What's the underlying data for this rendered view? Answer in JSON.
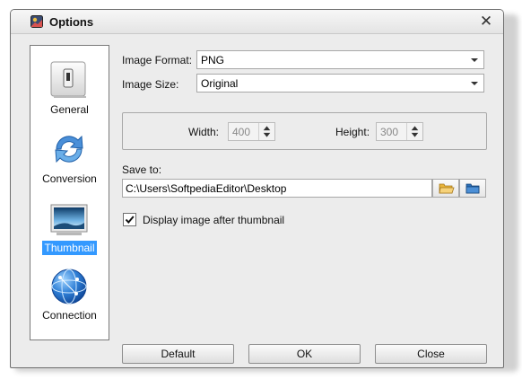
{
  "window": {
    "title": "Options",
    "close_glyph": "✕"
  },
  "sidebar": {
    "items": [
      {
        "label": "General",
        "icon": "switch-icon"
      },
      {
        "label": "Conversion",
        "icon": "refresh-arrows-icon"
      },
      {
        "label": "Thumbnail",
        "icon": "landscape-image-icon",
        "selected": true
      },
      {
        "label": "Connection",
        "icon": "globe-network-icon"
      }
    ]
  },
  "form": {
    "image_format_label": "Image Format:",
    "image_format_value": "PNG",
    "image_size_label": "Image Size:",
    "image_size_value": "Original",
    "width_label": "Width:",
    "width_value": "400",
    "height_label": "Height:",
    "height_value": "300",
    "save_to_label": "Save to:",
    "save_to_value": "C:\\Users\\SoftpediaEditor\\Desktop",
    "display_after_label": "Display image after thumbnail",
    "display_after_checked": true
  },
  "buttons": {
    "default": "Default",
    "ok": "OK",
    "close": "Close"
  },
  "colors": {
    "selection": "#3399ff",
    "folder": "#e8b43a",
    "accent_blue": "#2b6fb8"
  }
}
